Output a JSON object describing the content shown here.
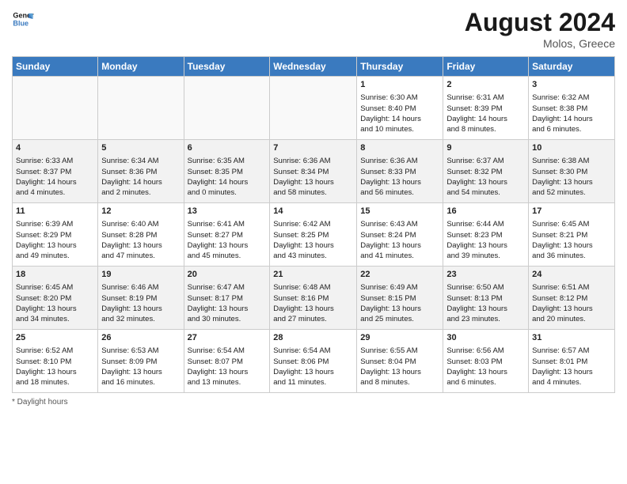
{
  "header": {
    "logo_line1": "General",
    "logo_line2": "Blue",
    "month_year": "August 2024",
    "location": "Molos, Greece"
  },
  "days_of_week": [
    "Sunday",
    "Monday",
    "Tuesday",
    "Wednesday",
    "Thursday",
    "Friday",
    "Saturday"
  ],
  "weeks": [
    [
      {
        "day": "",
        "data": ""
      },
      {
        "day": "",
        "data": ""
      },
      {
        "day": "",
        "data": ""
      },
      {
        "day": "",
        "data": ""
      },
      {
        "day": "1",
        "data": "Sunrise: 6:30 AM\nSunset: 8:40 PM\nDaylight: 14 hours\nand 10 minutes."
      },
      {
        "day": "2",
        "data": "Sunrise: 6:31 AM\nSunset: 8:39 PM\nDaylight: 14 hours\nand 8 minutes."
      },
      {
        "day": "3",
        "data": "Sunrise: 6:32 AM\nSunset: 8:38 PM\nDaylight: 14 hours\nand 6 minutes."
      }
    ],
    [
      {
        "day": "4",
        "data": "Sunrise: 6:33 AM\nSunset: 8:37 PM\nDaylight: 14 hours\nand 4 minutes."
      },
      {
        "day": "5",
        "data": "Sunrise: 6:34 AM\nSunset: 8:36 PM\nDaylight: 14 hours\nand 2 minutes."
      },
      {
        "day": "6",
        "data": "Sunrise: 6:35 AM\nSunset: 8:35 PM\nDaylight: 14 hours\nand 0 minutes."
      },
      {
        "day": "7",
        "data": "Sunrise: 6:36 AM\nSunset: 8:34 PM\nDaylight: 13 hours\nand 58 minutes."
      },
      {
        "day": "8",
        "data": "Sunrise: 6:36 AM\nSunset: 8:33 PM\nDaylight: 13 hours\nand 56 minutes."
      },
      {
        "day": "9",
        "data": "Sunrise: 6:37 AM\nSunset: 8:32 PM\nDaylight: 13 hours\nand 54 minutes."
      },
      {
        "day": "10",
        "data": "Sunrise: 6:38 AM\nSunset: 8:30 PM\nDaylight: 13 hours\nand 52 minutes."
      }
    ],
    [
      {
        "day": "11",
        "data": "Sunrise: 6:39 AM\nSunset: 8:29 PM\nDaylight: 13 hours\nand 49 minutes."
      },
      {
        "day": "12",
        "data": "Sunrise: 6:40 AM\nSunset: 8:28 PM\nDaylight: 13 hours\nand 47 minutes."
      },
      {
        "day": "13",
        "data": "Sunrise: 6:41 AM\nSunset: 8:27 PM\nDaylight: 13 hours\nand 45 minutes."
      },
      {
        "day": "14",
        "data": "Sunrise: 6:42 AM\nSunset: 8:25 PM\nDaylight: 13 hours\nand 43 minutes."
      },
      {
        "day": "15",
        "data": "Sunrise: 6:43 AM\nSunset: 8:24 PM\nDaylight: 13 hours\nand 41 minutes."
      },
      {
        "day": "16",
        "data": "Sunrise: 6:44 AM\nSunset: 8:23 PM\nDaylight: 13 hours\nand 39 minutes."
      },
      {
        "day": "17",
        "data": "Sunrise: 6:45 AM\nSunset: 8:21 PM\nDaylight: 13 hours\nand 36 minutes."
      }
    ],
    [
      {
        "day": "18",
        "data": "Sunrise: 6:45 AM\nSunset: 8:20 PM\nDaylight: 13 hours\nand 34 minutes."
      },
      {
        "day": "19",
        "data": "Sunrise: 6:46 AM\nSunset: 8:19 PM\nDaylight: 13 hours\nand 32 minutes."
      },
      {
        "day": "20",
        "data": "Sunrise: 6:47 AM\nSunset: 8:17 PM\nDaylight: 13 hours\nand 30 minutes."
      },
      {
        "day": "21",
        "data": "Sunrise: 6:48 AM\nSunset: 8:16 PM\nDaylight: 13 hours\nand 27 minutes."
      },
      {
        "day": "22",
        "data": "Sunrise: 6:49 AM\nSunset: 8:15 PM\nDaylight: 13 hours\nand 25 minutes."
      },
      {
        "day": "23",
        "data": "Sunrise: 6:50 AM\nSunset: 8:13 PM\nDaylight: 13 hours\nand 23 minutes."
      },
      {
        "day": "24",
        "data": "Sunrise: 6:51 AM\nSunset: 8:12 PM\nDaylight: 13 hours\nand 20 minutes."
      }
    ],
    [
      {
        "day": "25",
        "data": "Sunrise: 6:52 AM\nSunset: 8:10 PM\nDaylight: 13 hours\nand 18 minutes."
      },
      {
        "day": "26",
        "data": "Sunrise: 6:53 AM\nSunset: 8:09 PM\nDaylight: 13 hours\nand 16 minutes."
      },
      {
        "day": "27",
        "data": "Sunrise: 6:54 AM\nSunset: 8:07 PM\nDaylight: 13 hours\nand 13 minutes."
      },
      {
        "day": "28",
        "data": "Sunrise: 6:54 AM\nSunset: 8:06 PM\nDaylight: 13 hours\nand 11 minutes."
      },
      {
        "day": "29",
        "data": "Sunrise: 6:55 AM\nSunset: 8:04 PM\nDaylight: 13 hours\nand 8 minutes."
      },
      {
        "day": "30",
        "data": "Sunrise: 6:56 AM\nSunset: 8:03 PM\nDaylight: 13 hours\nand 6 minutes."
      },
      {
        "day": "31",
        "data": "Sunrise: 6:57 AM\nSunset: 8:01 PM\nDaylight: 13 hours\nand 4 minutes."
      }
    ]
  ],
  "footer": "Daylight hours"
}
